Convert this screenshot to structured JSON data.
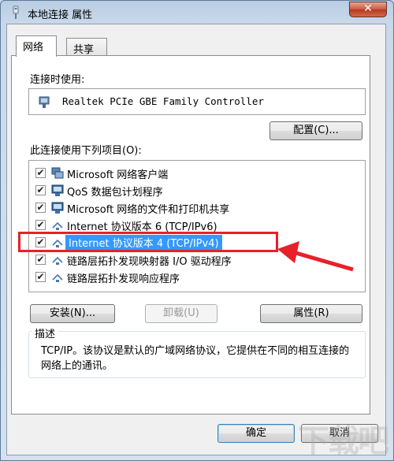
{
  "window": {
    "title": "本地连接 属性",
    "close_label": "✕"
  },
  "tabs": [
    {
      "label": "网络"
    },
    {
      "label": "共享"
    }
  ],
  "connect_using": {
    "label": "连接时使用:",
    "adapter": "Realtek PCIe GBE Family Controller",
    "configure_label": "配置(C)..."
  },
  "components": {
    "label": "此连接使用下列项目(O):",
    "items": [
      {
        "label": "Microsoft 网络客户端",
        "checked": true,
        "icon": "network-client-icon"
      },
      {
        "label": "QoS 数据包计划程序",
        "checked": true,
        "icon": "qos-icon"
      },
      {
        "label": "Microsoft 网络的文件和打印机共享",
        "checked": true,
        "icon": "file-printer-sharing-icon"
      },
      {
        "label": "Internet 协议版本 6 (TCP/IPv6)",
        "checked": true,
        "icon": "protocol-icon"
      },
      {
        "label": "Internet 协议版本 4 (TCP/IPv4)",
        "checked": true,
        "icon": "protocol-icon",
        "selected": true
      },
      {
        "label": "链路层拓扑发现映射器 I/O 驱动程序",
        "checked": true,
        "icon": "protocol-icon"
      },
      {
        "label": "链路层拓扑发现响应程序",
        "checked": true,
        "icon": "protocol-icon"
      }
    ]
  },
  "buttons": {
    "install": "安装(N)...",
    "uninstall": "卸载(U)",
    "properties": "属性(R)"
  },
  "description": {
    "title": "描述",
    "text": "TCP/IP。该协议是默认的广域网络协议，它提供在不同的相互连接的网络上的通讯。"
  },
  "footer": {
    "ok": "确定",
    "cancel": "取消"
  },
  "watermark": "下载吧",
  "colors": {
    "selection": "#3399ff",
    "highlight_box": "#e8202a"
  }
}
